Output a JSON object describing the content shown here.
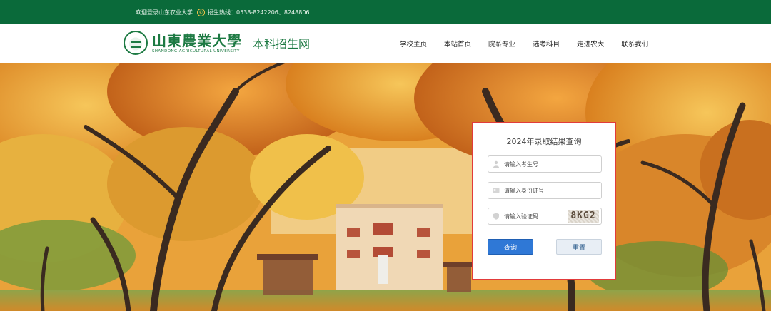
{
  "topbar": {
    "welcome": "欢迎登录山东农业大学",
    "hotline": "招生热线：0538-8242206、8248806"
  },
  "header": {
    "school_name_cn": "山東農業大學",
    "school_name_en": "SHANDONG AGRICULTURAL UNIVERSITY",
    "site_name": "本科招生网"
  },
  "nav": {
    "items": [
      {
        "label": "学校主页"
      },
      {
        "label": "本站首页"
      },
      {
        "label": "院系专业"
      },
      {
        "label": "选考科目"
      },
      {
        "label": "走进农大"
      },
      {
        "label": "联系我们"
      }
    ]
  },
  "query": {
    "title": "2024年录取结果查询",
    "candidate_placeholder": "请输入考生号",
    "id_placeholder": "请输入身份证号",
    "captcha_placeholder": "请输入验证码",
    "captcha_text": "8KG2",
    "query_label": "查询",
    "reset_label": "重置"
  },
  "colors": {
    "brand_green": "#0a6a3a",
    "card_border": "#e23b3b",
    "button_blue": "#2f78d6"
  }
}
